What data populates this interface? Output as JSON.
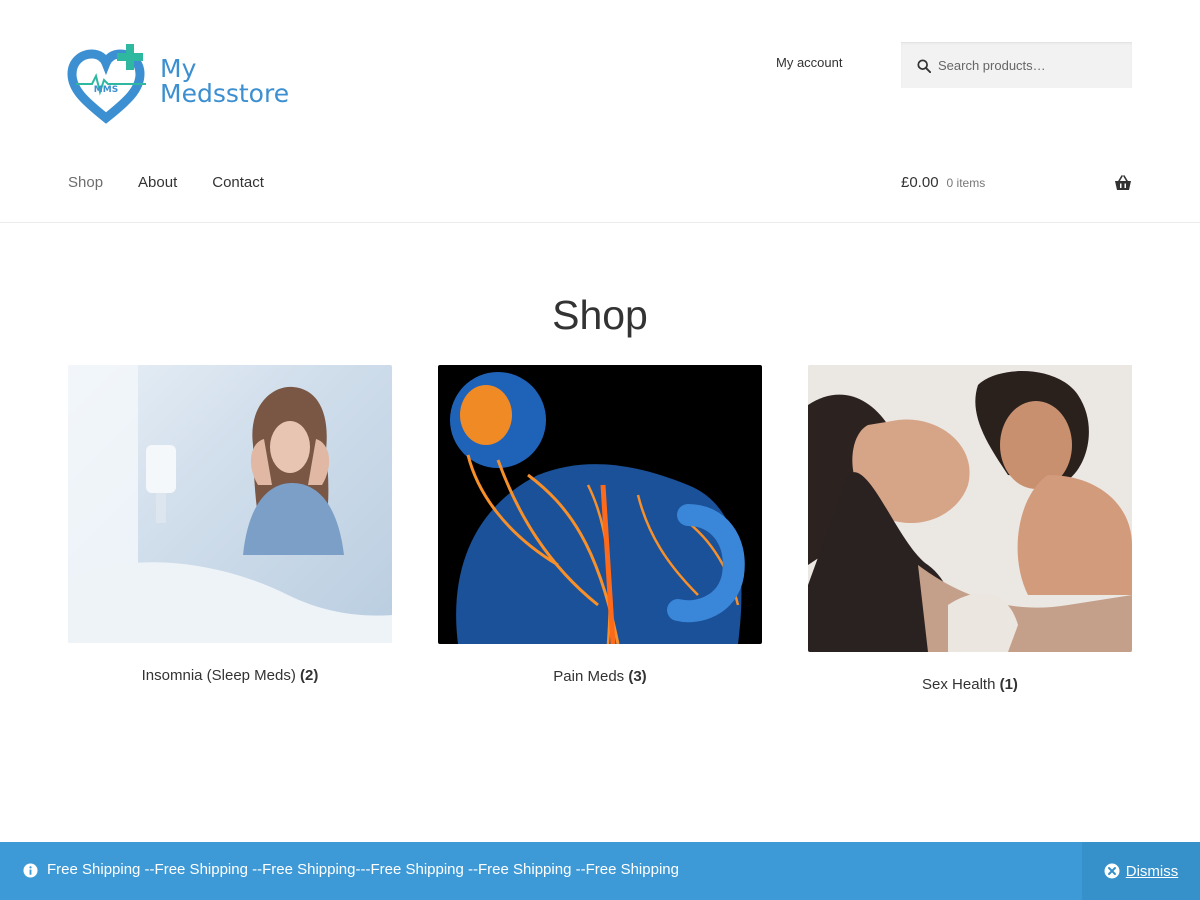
{
  "brand": {
    "logo_line1": "My",
    "logo_line2": "Medsstore",
    "logo_badge": "MMS",
    "primary_color": "#3c8fd0",
    "accent_color": "#2eb8a0"
  },
  "header": {
    "my_account": "My account",
    "search_placeholder": "Search products…",
    "nav": [
      {
        "label": "Shop"
      },
      {
        "label": "About"
      },
      {
        "label": "Contact"
      }
    ],
    "cart": {
      "amount": "£0.00",
      "count": "0 items",
      "icon": "basket-icon"
    }
  },
  "page_title": "Shop",
  "categories": [
    {
      "name": "Insomnia (Sleep Meds)",
      "count": "(2)"
    },
    {
      "name": "Pain Meds",
      "count": "(3)"
    },
    {
      "name": "Sex Health",
      "count": "(1)"
    }
  ],
  "notice": {
    "icon": "info-icon",
    "message": "Free Shipping --Free Shipping --Free Shipping---Free Shipping --Free Shipping --Free Shipping",
    "dismiss_label": "Dismiss",
    "dismiss_icon": "close-circle-icon",
    "bar_color": "#3e9ad6"
  }
}
